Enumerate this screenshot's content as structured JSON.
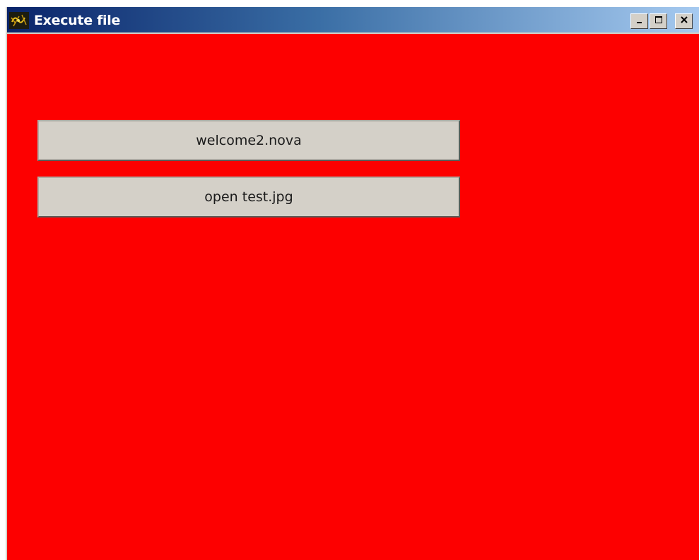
{
  "window": {
    "title": "Execute file",
    "background_color": "#fd0000",
    "app_icon": "java-cup-icon",
    "controls": {
      "minimize": "minimize-icon",
      "maximize": "maximize-icon",
      "close": "close-icon"
    }
  },
  "buttons": {
    "first_label": "welcome2.nova",
    "second_label": "open test.jpg"
  }
}
